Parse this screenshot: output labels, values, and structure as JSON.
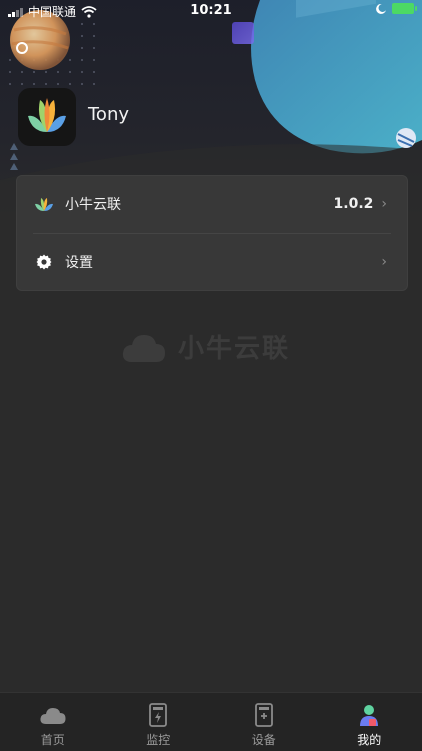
{
  "status_bar": {
    "carrier": "中国联通",
    "time": "10:21"
  },
  "profile": {
    "username": "Tony"
  },
  "menu": {
    "items": [
      {
        "label": "小牛云联",
        "value": "1.0.2"
      },
      {
        "label": "设置",
        "value": ""
      }
    ]
  },
  "watermark": {
    "text": "小牛云联"
  },
  "tabs": [
    {
      "label": "首页",
      "icon": "cloud-icon",
      "active": false
    },
    {
      "label": "监控",
      "icon": "monitor-icon",
      "active": false
    },
    {
      "label": "设备",
      "icon": "device-icon",
      "active": false
    },
    {
      "label": "我的",
      "icon": "user-icon",
      "active": true
    }
  ],
  "colors": {
    "accent": "#4cd964",
    "card_bg": "#383838",
    "page_bg": "#2b2b2b"
  }
}
